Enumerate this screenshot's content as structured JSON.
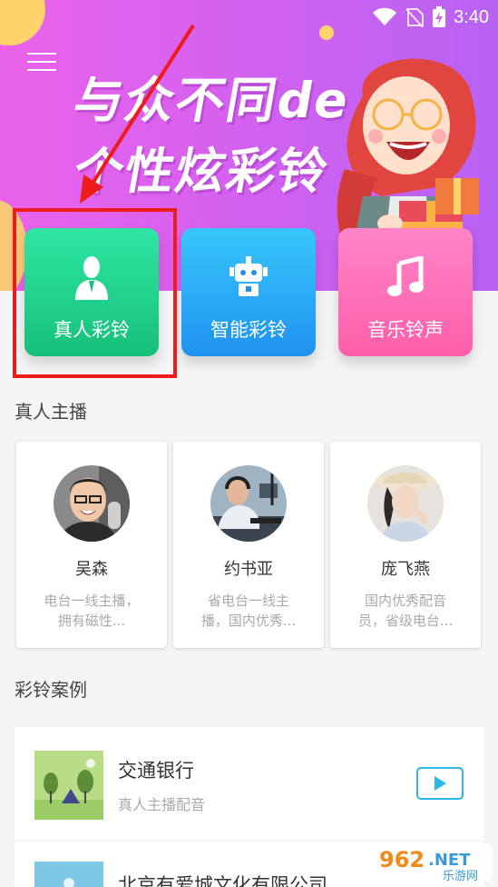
{
  "status_bar": {
    "time": "3:40"
  },
  "banner": {
    "line1": "与众不同de",
    "line2": "个性炫彩铃"
  },
  "tiles": [
    {
      "label": "真人彩铃",
      "icon": "person-icon",
      "color": "#1dcf8a"
    },
    {
      "label": "智能彩铃",
      "icon": "robot-icon",
      "color": "#29a9f6"
    },
    {
      "label": "音乐铃声",
      "icon": "music-note-icon",
      "color": "#ff6db5"
    }
  ],
  "hosts_section": {
    "title": "真人主播",
    "hosts": [
      {
        "name": "吴森",
        "desc": "电台一线主播，拥有磁性..."
      },
      {
        "name": "约书亚",
        "desc": "省电台一线主播，国内优秀..."
      },
      {
        "name": "庞飞燕",
        "desc": "国内优秀配音员，省级电台..."
      }
    ]
  },
  "cases_section": {
    "title": "彩铃案例",
    "cases": [
      {
        "title": "交通银行",
        "subtitle": "真人主播配音"
      },
      {
        "title": "北京有爱城文化有限公司",
        "subtitle": ""
      }
    ]
  },
  "watermark": {
    "brand_number": "962",
    "brand_net": ".NET",
    "brand_cn": "乐游网"
  },
  "colors": {
    "highlight": "#ee1b1b",
    "accent_blue": "#2bb8e6"
  }
}
